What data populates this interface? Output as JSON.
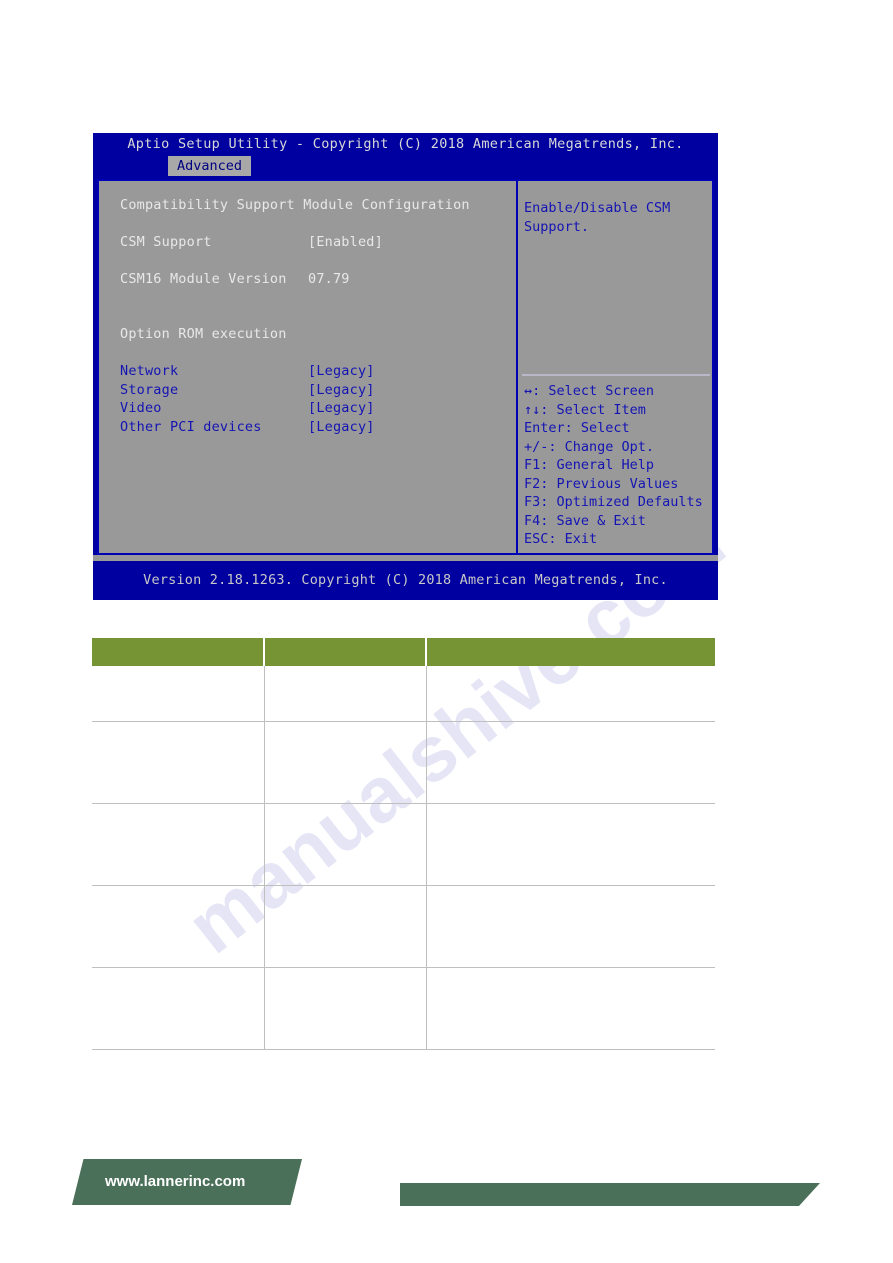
{
  "bios": {
    "title": "Aptio Setup Utility - Copyright (C) 2018 American Megatrends, Inc.",
    "active_tab": "Advanced",
    "section_heading": "Compatibility Support Module Configuration",
    "settings": [
      {
        "label": "CSM Support",
        "value": "[Enabled]",
        "highlight": false
      },
      {
        "label": "CSM16 Module Version",
        "value": "07.79",
        "highlight": false
      }
    ],
    "group_heading": "Option ROM execution",
    "rom_settings": [
      {
        "label": "Network",
        "value": "[Legacy]"
      },
      {
        "label": "Storage",
        "value": "[Legacy]"
      },
      {
        "label": "Video",
        "value": "[Legacy]"
      },
      {
        "label": "Other PCI devices",
        "value": "[Legacy]"
      }
    ],
    "help": "Enable/Disable CSM\nSupport.",
    "keys": [
      "↔: Select Screen",
      "↑↓: Select Item",
      "Enter: Select",
      "+/-: Change Opt.",
      "F1: General Help",
      "F2: Previous Values",
      "F3: Optimized Defaults",
      "F4: Save & Exit",
      "ESC: Exit"
    ],
    "footer": "Version 2.18.1263. Copyright (C) 2018 American Megatrends, Inc.",
    "colors": {
      "titlebar_blue": "#0000a0",
      "panel_gray": "#999999",
      "border_blue": "#0000b4",
      "text_blue": "#1414b4",
      "text_white": "#e8e8e8"
    }
  },
  "table": {
    "header_color": "#769434",
    "headers": [
      "",
      "",
      ""
    ],
    "rows": [
      [
        "",
        "",
        ""
      ],
      [
        "",
        "",
        ""
      ],
      [
        "",
        "",
        ""
      ],
      [
        "",
        "",
        ""
      ],
      [
        "",
        "",
        ""
      ]
    ]
  },
  "watermark": {
    "text": "manualshive.com"
  },
  "footer": {
    "url": "www.lannerinc.com",
    "color": "#4a7059"
  }
}
